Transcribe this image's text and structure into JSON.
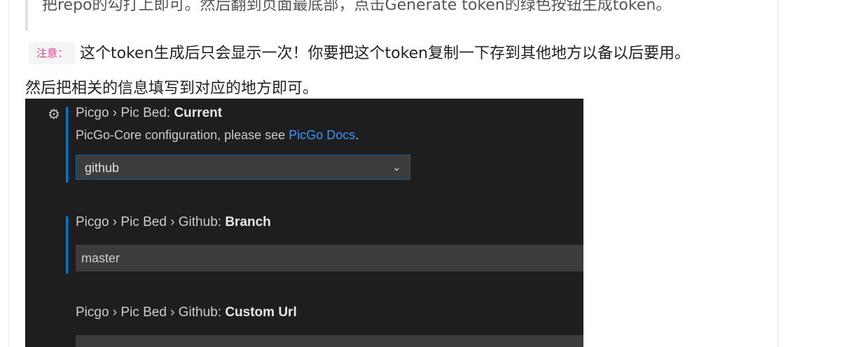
{
  "article": {
    "quote_text": "把repo的勾打上即可。然后翻到页面最底部，点击Generate token的绿色按钮生成token。",
    "note_label": "注意：",
    "note_text": "这个token生成后只会显示一次！你要把这个token复制一下存到其他地方以备以后要用。",
    "paragraph": "然后把相关的信息填写到对应的地方即可。"
  },
  "settings": {
    "current": {
      "prefix": "Picgo › Pic Bed: ",
      "name": "Current",
      "description_prefix": "PicGo-Core configuration, please see ",
      "description_link": "PicGo Docs",
      "description_suffix": ".",
      "value": "github"
    },
    "branch": {
      "prefix": "Picgo › Pic Bed › Github: ",
      "name": "Branch",
      "value": "master"
    },
    "custom_url": {
      "prefix": "Picgo › Pic Bed › Github: ",
      "name": "Custom Url",
      "value": ""
    }
  },
  "icons": {
    "settings": "gear-icon",
    "dropdown": "chevron-down-icon"
  },
  "colors": {
    "accent": "#007acc",
    "link": "#3794ff",
    "note": "#e83e8c",
    "editor_bg": "#1e1e1e"
  }
}
